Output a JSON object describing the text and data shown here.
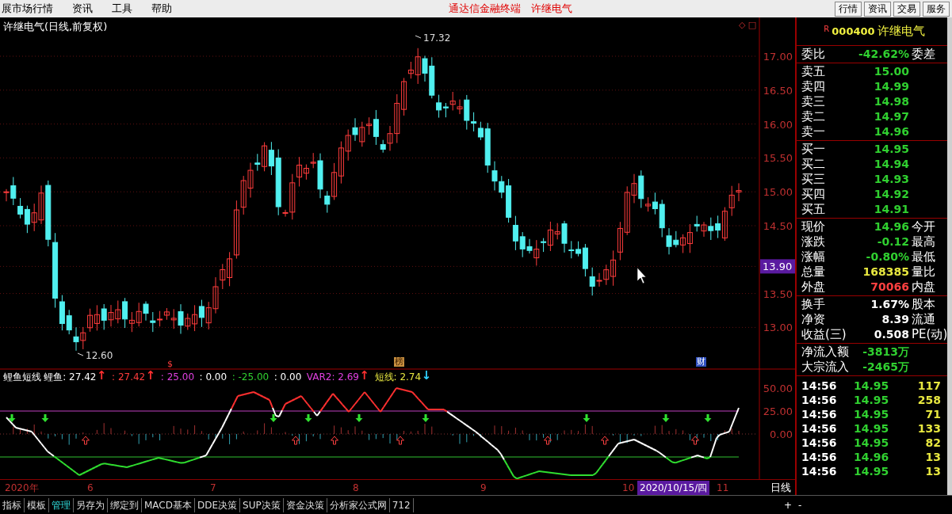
{
  "menu": [
    {
      "label": "展市场行情"
    },
    {
      "label": "资讯"
    },
    {
      "label": "工具"
    },
    {
      "label": "帮助"
    }
  ],
  "window_title": [
    "通达信金融终端",
    "许继电气"
  ],
  "quick_buttons": [
    "行情",
    "资讯",
    "交易",
    "服务"
  ],
  "chart": {
    "title": "许继电气(日线,前复权)",
    "corner_marks": [
      "◇",
      "□"
    ],
    "price_axis": [
      "17.00",
      "16.50",
      "16.00",
      "15.50",
      "15.00",
      "14.50",
      "13.50",
      "13.00"
    ],
    "cursor_price": "13.90",
    "high_label": "17.32",
    "low_label": "12.60",
    "markers": [
      {
        "text": "$",
        "kind": "dividend"
      },
      {
        "text": "榜",
        "kind": "ranking"
      },
      {
        "text": "财",
        "kind": "report"
      }
    ]
  },
  "indicator": {
    "name": "鲤鱼短线",
    "axis": [
      "50.00",
      "25.00",
      "0.00"
    ],
    "values": [
      {
        "text": "鲤鱼: 27.42",
        "color": "#ffffff",
        "arrow": {
          "text": "↑",
          "color": "#ff3030"
        }
      },
      {
        "text": ": 27.42",
        "color": "#ff3c3c",
        "arrow": {
          "text": "↑",
          "color": "#ff3030"
        }
      },
      {
        "text": ": 25.00",
        "color": "#e040e0"
      },
      {
        "text": ": 0.00",
        "color": "#ffffff"
      },
      {
        "text": ": -25.00",
        "color": "#30d030"
      },
      {
        "text": ": 0.00",
        "color": "#ffffff"
      },
      {
        "text": "VAR2: 2.69",
        "color": "#e040e0",
        "arrow": {
          "text": "↑",
          "color": "#ff3030"
        }
      },
      {
        "text": "短线: 2.74",
        "color": "#e8e840",
        "arrow": {
          "text": "↓",
          "color": "#30d0ff"
        }
      }
    ]
  },
  "date_axis": {
    "labels": [
      "2020年",
      "6",
      "7",
      "8",
      "9",
      "10",
      "11"
    ],
    "cursor_date": "2020/10/15/四",
    "period": "日线"
  },
  "tabs": [
    {
      "label": "指标",
      "selected": false
    },
    {
      "label": "模板",
      "selected": false
    },
    {
      "label": "管理",
      "selected": true
    },
    {
      "label": "另存为",
      "selected": false
    },
    {
      "label": "绑定到",
      "selected": false
    },
    {
      "label": "MACD基本",
      "selected": false
    },
    {
      "label": "DDE决策",
      "selected": false
    },
    {
      "label": "SUP决策",
      "selected": false
    },
    {
      "label": "资金决策",
      "selected": false
    },
    {
      "label": "分析家公式网",
      "selected": false
    },
    {
      "label": "712",
      "selected": false
    }
  ],
  "zoom_buttons": [
    "+",
    "-"
  ],
  "quote": {
    "flag": "R",
    "code": "000400",
    "name": "许继电气",
    "sections": [
      [
        {
          "label": "委比",
          "value": "-42.62%",
          "color": "#30d030",
          "label2": "委差"
        }
      ],
      [
        {
          "label": "卖五",
          "value": "15.00",
          "color": "#30d030"
        },
        {
          "label": "卖四",
          "value": "14.99",
          "color": "#30d030"
        },
        {
          "label": "卖三",
          "value": "14.98",
          "color": "#30d030"
        },
        {
          "label": "卖二",
          "value": "14.97",
          "color": "#30d030"
        },
        {
          "label": "卖一",
          "value": "14.96",
          "color": "#30d030"
        }
      ],
      [
        {
          "label": "买一",
          "value": "14.95",
          "color": "#30d030"
        },
        {
          "label": "买二",
          "value": "14.94",
          "color": "#30d030"
        },
        {
          "label": "买三",
          "value": "14.93",
          "color": "#30d030"
        },
        {
          "label": "买四",
          "value": "14.92",
          "color": "#30d030"
        },
        {
          "label": "买五",
          "value": "14.91",
          "color": "#30d030"
        }
      ],
      [
        {
          "label": "现价",
          "value": "14.96",
          "color": "#30d030",
          "label2": "今开"
        },
        {
          "label": "涨跌",
          "value": "-0.12",
          "color": "#30d030",
          "label2": "最高"
        },
        {
          "label": "涨幅",
          "value": "-0.80%",
          "color": "#30d030",
          "label2": "最低"
        },
        {
          "label": "总量",
          "value": "168385",
          "color": "#e8e840",
          "label2": "量比"
        },
        {
          "label": "外盘",
          "value": "70066",
          "color": "#ff4040",
          "label2": "内盘"
        }
      ],
      [
        {
          "label": "换手",
          "value": "1.67%",
          "color": "#ffffff",
          "label2": "股本"
        },
        {
          "label": "净资",
          "value": "8.39",
          "color": "#ffffff",
          "label2": "流通"
        },
        {
          "label": "收益(三)",
          "value": "0.508",
          "color": "#ffffff",
          "label2": "PE(动)"
        }
      ],
      [
        {
          "label": "净流入额",
          "value": "-3813万",
          "color": "#30d030"
        },
        {
          "label": "大宗流入",
          "value": "-2465万",
          "color": "#30d030"
        }
      ]
    ],
    "trades": [
      {
        "time": "14:56",
        "price": "14.95",
        "volume": "117"
      },
      {
        "time": "14:56",
        "price": "14.95",
        "volume": "258"
      },
      {
        "time": "14:56",
        "price": "14.95",
        "volume": "71"
      },
      {
        "time": "14:56",
        "price": "14.95",
        "volume": "133"
      },
      {
        "time": "14:56",
        "price": "14.95",
        "volume": "82"
      },
      {
        "time": "14:56",
        "price": "14.96",
        "volume": "13"
      },
      {
        "time": "14:56",
        "price": "14.95",
        "volume": "13"
      }
    ]
  }
}
